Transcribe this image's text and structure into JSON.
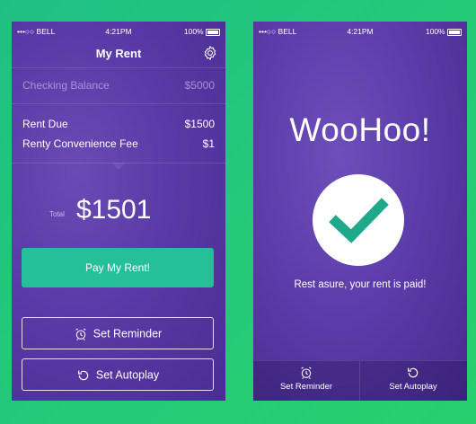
{
  "left_screen": {
    "status": {
      "carrier": "•••○○ BELL",
      "time": "4:21PM",
      "battery": "100%"
    },
    "nav_title": "My Rent",
    "checking": {
      "label": "Checking Balance",
      "value": "$5000"
    },
    "rent_due": {
      "label": "Rent Due",
      "value": "$1500"
    },
    "fee": {
      "label": "Renty Convenience Fee",
      "value": "$1"
    },
    "total_label": "Total",
    "total_amount": "$1501",
    "pay_button": "Pay My Rent!",
    "reminder_button": "Set Reminder",
    "autopay_button": "Set Autoplay"
  },
  "right_screen": {
    "status": {
      "carrier": "•••○○ BELL",
      "time": "4:21PM",
      "battery": "100%"
    },
    "headline": "WooHoo!",
    "message": "Rest asure, your rent is paid!",
    "tab_reminder": "Set Reminder",
    "tab_autopay": "Set Autoplay"
  },
  "colors": {
    "background": "#22c97a",
    "phone_purple": "#5a3aa6",
    "accent_teal": "#25c09a",
    "checkmark": "#1fa88a"
  },
  "icons": [
    "gear-icon",
    "alarm-clock-icon",
    "refresh-icon",
    "checkmark-icon",
    "wifi-icon",
    "bluetooth-icon",
    "battery-icon"
  ]
}
